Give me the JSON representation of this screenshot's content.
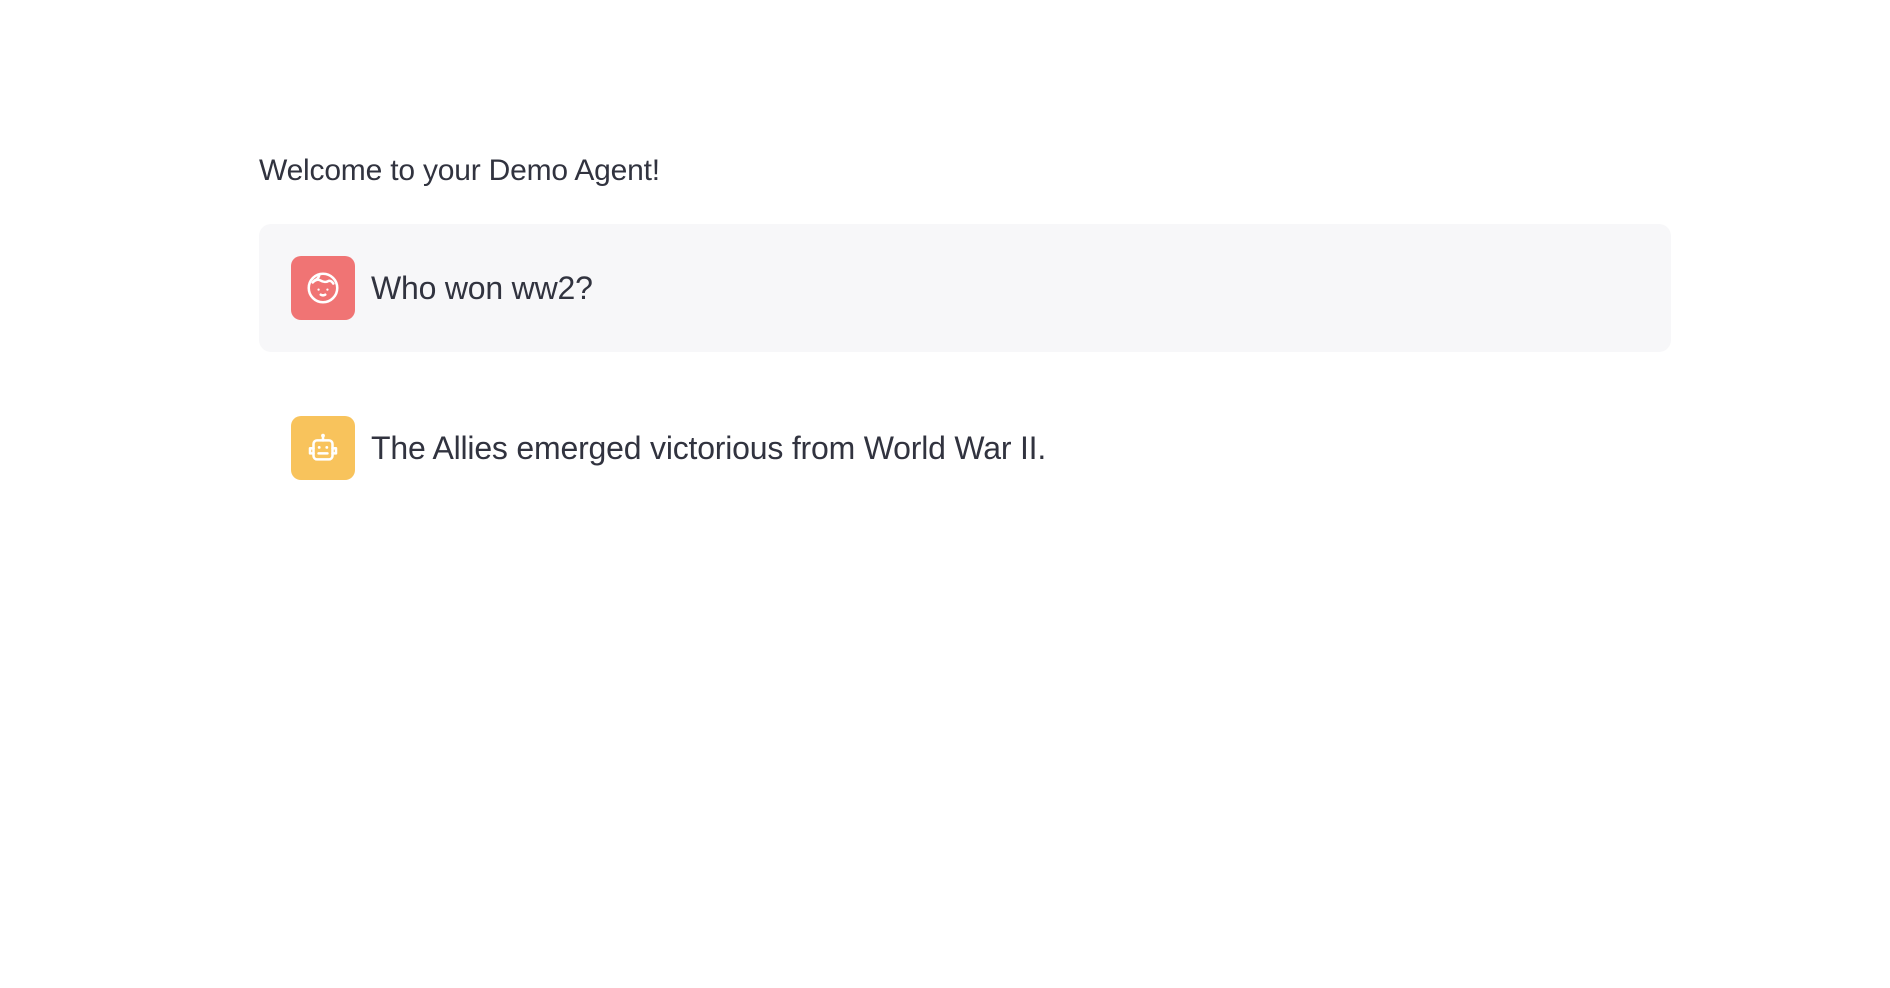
{
  "app": {
    "intro_text": "Welcome to your Demo Agent!"
  },
  "messages": [
    {
      "role": "user",
      "avatar_icon": "user-face-icon",
      "avatar_color": "#f07474",
      "text": "Who won ww2?"
    },
    {
      "role": "assistant",
      "avatar_icon": "robot-icon",
      "avatar_color": "#f8c35c",
      "text": "The Allies emerged victorious from World War II."
    }
  ],
  "colors": {
    "text": "#31333f",
    "user_bubble_bg": "#f7f7f9",
    "page_bg": "#ffffff"
  }
}
